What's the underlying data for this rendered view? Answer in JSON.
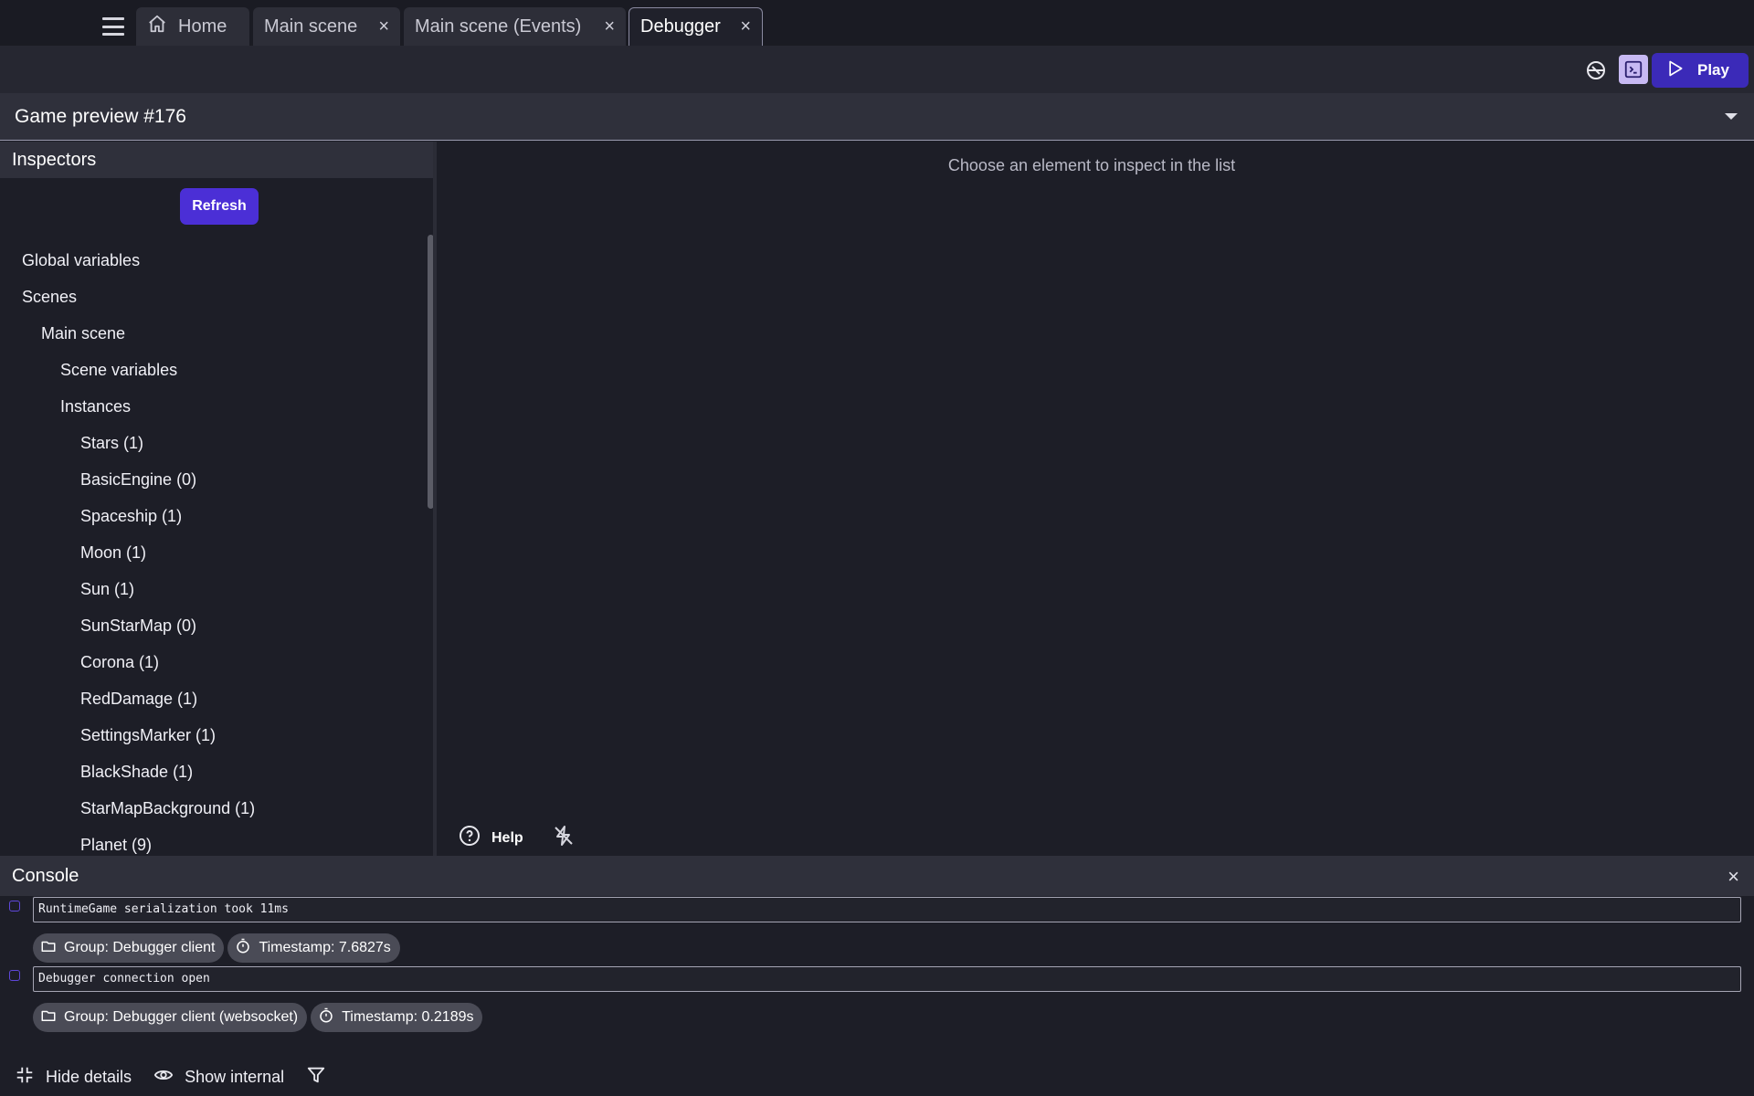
{
  "tabs": {
    "home": "Home",
    "main_scene": "Main scene",
    "main_scene_events": "Main scene (Events)",
    "debugger": "Debugger",
    "close_glyph": "×"
  },
  "toolbar": {
    "play_label": "Play"
  },
  "preview": {
    "title": "Game preview #176"
  },
  "inspectors": {
    "title": "Inspectors",
    "refresh_label": "Refresh",
    "items": [
      {
        "label": "Global variables",
        "level": 0
      },
      {
        "label": "Scenes",
        "level": 0
      },
      {
        "label": "Main scene",
        "level": 1
      },
      {
        "label": "Scene variables",
        "level": 2
      },
      {
        "label": "Instances",
        "level": 2
      },
      {
        "label": "Stars (1)",
        "level": 3
      },
      {
        "label": "BasicEngine (0)",
        "level": 3
      },
      {
        "label": "Spaceship (1)",
        "level": 3
      },
      {
        "label": "Moon (1)",
        "level": 3
      },
      {
        "label": "Sun (1)",
        "level": 3
      },
      {
        "label": "SunStarMap (0)",
        "level": 3
      },
      {
        "label": "Corona (1)",
        "level": 3
      },
      {
        "label": "RedDamage (1)",
        "level": 3
      },
      {
        "label": "SettingsMarker (1)",
        "level": 3
      },
      {
        "label": "BlackShade (1)",
        "level": 3
      },
      {
        "label": "StarMapBackground (1)",
        "level": 3
      },
      {
        "label": "Planet (9)",
        "level": 3
      }
    ]
  },
  "main": {
    "choose_message": "Choose an element to inspect in the list",
    "help_label": "Help"
  },
  "console": {
    "title": "Console",
    "logs": [
      {
        "message": "RuntimeGame serialization took 11ms",
        "group": "Group: Debugger client",
        "timestamp": "Timestamp: 7.6827s"
      },
      {
        "message": "Debugger connection open",
        "group": "Group: Debugger client (websocket)",
        "timestamp": "Timestamp: 0.2189s"
      }
    ],
    "hide_details_label": "Hide details",
    "show_internal_label": "Show internal"
  },
  "colors": {
    "accent": "#4b2fd6",
    "play_button": "#3b2ab8",
    "background": "#1d1e27"
  },
  "icons": [
    "menu-icon",
    "home-icon",
    "close-icon",
    "network-icon",
    "console-icon",
    "play-icon",
    "dropdown-caret-icon",
    "help-icon",
    "flash-off-icon",
    "info-icon",
    "folder-icon",
    "timer-icon",
    "collapse-icon",
    "eye-icon",
    "filter-icon"
  ]
}
